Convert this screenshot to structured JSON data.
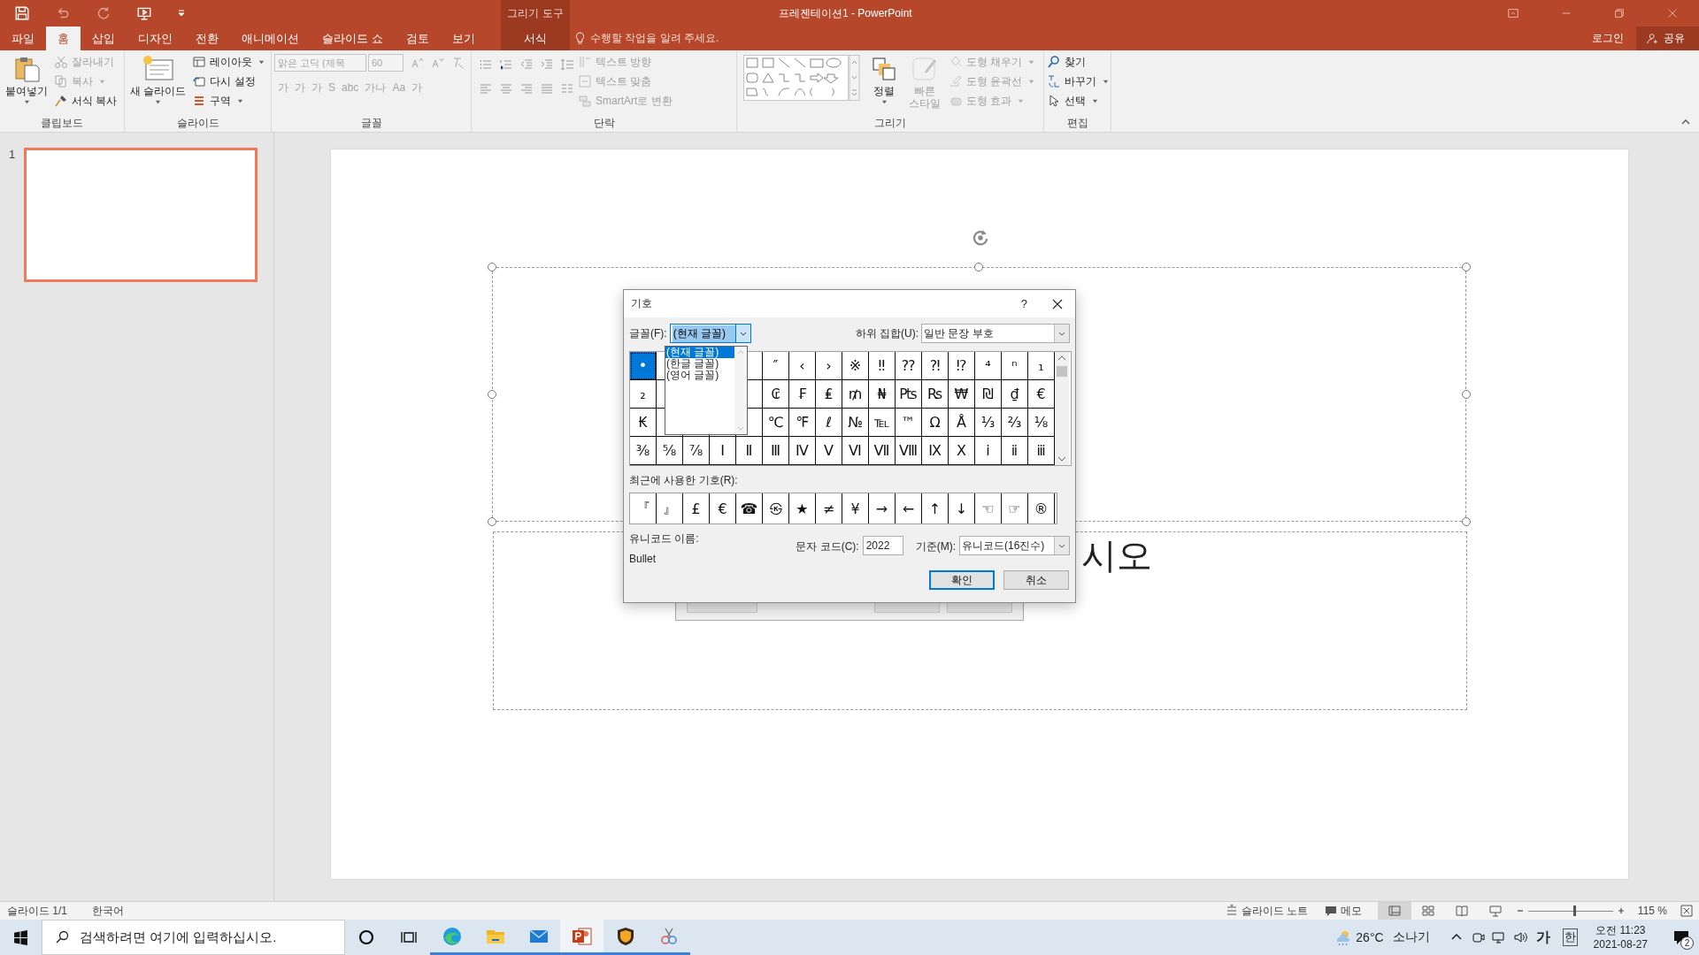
{
  "title_bar": {
    "title": "프레젠테이션1 - PowerPoint"
  },
  "tabs": [
    {
      "label": "파일",
      "selected": false
    },
    {
      "label": "홈",
      "selected": true
    },
    {
      "label": "삽입",
      "selected": false
    },
    {
      "label": "디자인",
      "selected": false
    },
    {
      "label": "전환",
      "selected": false
    },
    {
      "label": "애니메이션",
      "selected": false
    },
    {
      "label": "슬라이드 쇼",
      "selected": false
    },
    {
      "label": "검토",
      "selected": false
    },
    {
      "label": "보기",
      "selected": false
    }
  ],
  "context_tab": {
    "header": "그리기 도구",
    "label": "서식",
    "selected": false
  },
  "tell_me": "수행할 작업을 알려 주세요.",
  "account": {
    "login": "로그인",
    "share": "공유"
  },
  "ribbon": {
    "clipboard": {
      "label": "클립보드",
      "paste": {
        "label": "붙여넣기",
        "disabled": false
      },
      "cut": {
        "label": "잘라내기",
        "disabled": true
      },
      "copy": {
        "label": "복사",
        "disabled": true
      },
      "format_painter": {
        "label": "서식 복사",
        "disabled": false
      }
    },
    "slides": {
      "label": "슬라이드",
      "new_slide": "새 슬라이드",
      "layout": "레이아웃",
      "reset": "다시 설정",
      "section": "구역"
    },
    "font": {
      "label": "글꼴",
      "font_name": "맑은 고딕 (제목",
      "font_size": "60",
      "format_buttons": [
        "가",
        "가",
        "가",
        "S",
        "abc",
        "가나",
        "Aa",
        "가"
      ]
    },
    "paragraph": {
      "label": "단락",
      "text_direction": "텍스트 방향",
      "align_text": "텍스트 맞춤",
      "smartart": "SmartArt로 변환"
    },
    "drawing": {
      "label": "그리기",
      "arrange": {
        "label": "정렬",
        "disabled": false
      },
      "quick_styles": {
        "label": "빠른 스타일",
        "disabled": true
      },
      "shape_fill": {
        "label": "도형 채우기",
        "disabled": true
      },
      "shape_outline": {
        "label": "도형 윤곽선",
        "disabled": true
      },
      "shape_effects": {
        "label": "도형 효과",
        "disabled": true
      }
    },
    "editing": {
      "label": "편집",
      "find": "찾기",
      "replace": "바꾸기",
      "select": "선택"
    }
  },
  "slides_pane": {
    "number": "1",
    "selected": true
  },
  "slide": {
    "title_placeholder": {
      "selected": true
    },
    "subtitle_fragment": "시오"
  },
  "dialog": {
    "title": "기호",
    "help": "?",
    "font_label": "글꼴(F):",
    "font_value": "(현재 글꼴)",
    "font_options": [
      {
        "label": "(현재 글꼴)",
        "selected": true
      },
      {
        "label": "(한글 글꼴)",
        "selected": false
      },
      {
        "label": "(영어 글꼴)",
        "selected": false
      }
    ],
    "subset_label": "하위 집합(U):",
    "subset_value": "일반 문장 부호",
    "symbol_rows": [
      {
        "start": [
          {
            "char": "•",
            "selected": true
          }
        ],
        "end": [
          {
            "char": "″",
            "selected": false
          },
          {
            "char": "‹",
            "selected": false
          },
          {
            "char": "›",
            "selected": false
          },
          {
            "char": "※",
            "selected": false
          },
          {
            "char": "‼",
            "selected": false
          },
          {
            "char": "⁇",
            "selected": false
          },
          {
            "char": "⁈",
            "selected": false
          },
          {
            "char": "⁉",
            "selected": false
          },
          {
            "char": "⁴",
            "selected": false
          },
          {
            "char": "ⁿ",
            "selected": false
          },
          {
            "char": "₁",
            "selected": false
          }
        ]
      },
      {
        "start": [
          {
            "char": "₂",
            "selected": false
          }
        ],
        "end": [
          {
            "char": "₢",
            "selected": false
          },
          {
            "char": "₣",
            "selected": false
          },
          {
            "char": "₤",
            "selected": false
          },
          {
            "char": "₥",
            "selected": false
          },
          {
            "char": "₦",
            "selected": false
          },
          {
            "char": "₧",
            "selected": false
          },
          {
            "char": "₨",
            "selected": false
          },
          {
            "char": "₩",
            "selected": false
          },
          {
            "char": "₪",
            "selected": false
          },
          {
            "char": "₫",
            "selected": false
          },
          {
            "char": "€",
            "selected": false
          }
        ]
      },
      {
        "start": [
          {
            "char": "₭",
            "selected": false
          }
        ],
        "end": [
          {
            "char": "℃",
            "selected": false
          },
          {
            "char": "℉",
            "selected": false
          },
          {
            "char": "ℓ",
            "selected": false
          },
          {
            "char": "№",
            "selected": false
          },
          {
            "char": "℡",
            "selected": false
          },
          {
            "char": "™",
            "selected": false
          },
          {
            "char": "Ω",
            "selected": false
          },
          {
            "char": "Å",
            "selected": false
          },
          {
            "char": "⅓",
            "selected": false
          },
          {
            "char": "⅔",
            "selected": false
          },
          {
            "char": "⅛",
            "selected": false
          }
        ]
      },
      {
        "start": [
          {
            "char": "⅜",
            "selected": false
          },
          {
            "char": "⅝",
            "selected": false
          },
          {
            "char": "⅞",
            "selected": false
          },
          {
            "char": "Ⅰ",
            "selected": false
          },
          {
            "char": "Ⅱ",
            "selected": false
          },
          {
            "char": "Ⅲ",
            "selected": false
          },
          {
            "char": "Ⅳ",
            "selected": false
          },
          {
            "char": "Ⅴ",
            "selected": false
          },
          {
            "char": "Ⅵ",
            "selected": false
          },
          {
            "char": "Ⅶ",
            "selected": false
          },
          {
            "char": "Ⅷ",
            "selected": false
          },
          {
            "char": "Ⅸ",
            "selected": false
          },
          {
            "char": "Ⅹ",
            "selected": false
          },
          {
            "char": "ⅰ",
            "selected": false
          },
          {
            "char": "ⅱ",
            "selected": false
          },
          {
            "char": "ⅲ",
            "selected": false
          }
        ]
      }
    ],
    "recent_label": "최근에 사용한 기호(R):",
    "recent": [
      "『",
      "』",
      "£",
      "€",
      "☎",
      "㉿",
      "★",
      "≠",
      "¥",
      "→",
      "←",
      "↑",
      "↓",
      "☜",
      "☞",
      "®"
    ],
    "unicode_name_label": "유니코드 이름:",
    "unicode_name": "Bullet",
    "char_code_label": "문자 코드(C):",
    "char_code": "2022",
    "from_label": "기준(M):",
    "from_value": "유니코드(16진수)",
    "buttons": [
      {
        "label": "확인",
        "default": true
      },
      {
        "label": "취소",
        "default": false
      }
    ]
  },
  "status_bar": {
    "slide": "슬라이드 1/1",
    "language": "한국어",
    "notes": "슬라이드 노트",
    "comments": "메모",
    "views": [
      {
        "kind": "normal",
        "selected": true
      },
      {
        "kind": "sorter",
        "selected": false
      },
      {
        "kind": "reading",
        "selected": false
      },
      {
        "kind": "slideshow",
        "selected": false
      }
    ],
    "zoom_level": {
      "level": 0.54
    },
    "zoom": "115 %"
  },
  "taskbar": {
    "search_placeholder": "검색하려면 여기에 입력하십시오.",
    "apps": [
      {
        "kind": "browser",
        "selected": false
      },
      {
        "kind": "folder",
        "selected": false
      },
      {
        "kind": "mail",
        "selected": false
      },
      {
        "kind": "presentation",
        "selected": true
      },
      {
        "kind": "shield",
        "selected": false
      },
      {
        "kind": "scissors",
        "selected": false
      }
    ],
    "temperature": "26°C",
    "condition": "소나기",
    "ime": "가",
    "ime_mode": "한",
    "time": "오전 11:23",
    "date": "2021-08-27",
    "notifications": "2"
  }
}
